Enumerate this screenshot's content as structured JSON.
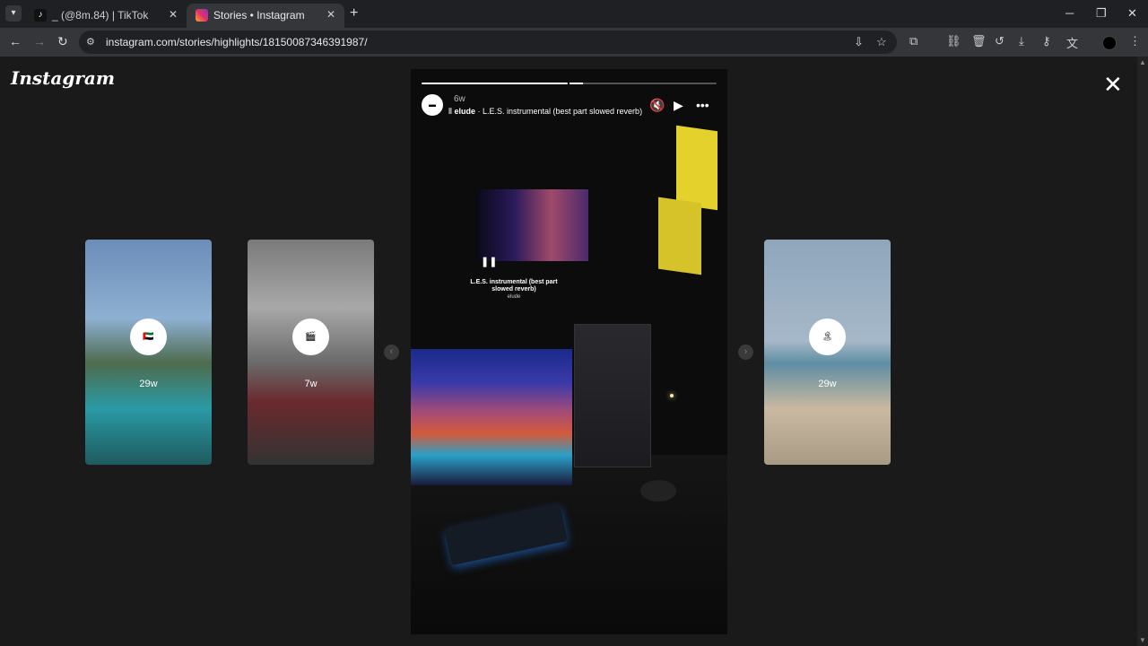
{
  "browser": {
    "tabs": [
      {
        "title": "_ (@8m.84) | TikTok",
        "favicon": "tiktok-icon",
        "active": false
      },
      {
        "title": "Stories • Instagram",
        "favicon": "instagram-icon",
        "active": true
      }
    ],
    "url": "instagram.com/stories/highlights/18150087346391987/"
  },
  "page": {
    "logo": "Instagram",
    "side_stories": [
      {
        "age": "29w",
        "avatar_emoji": "🇦🇪"
      },
      {
        "age": "7w",
        "avatar_emoji": "🎬"
      },
      {
        "age": "29w",
        "avatar_emoji": "🏝"
      }
    ],
    "story": {
      "age": "6w",
      "artist": "elude",
      "track": "L.E.S. instrumental (best part slowed reverb)",
      "music_sticker_title": "L.E.S. instrumental (best part slowed reverb)",
      "music_sticker_artist": "elude",
      "progress": [
        1.0,
        0.09
      ]
    }
  }
}
